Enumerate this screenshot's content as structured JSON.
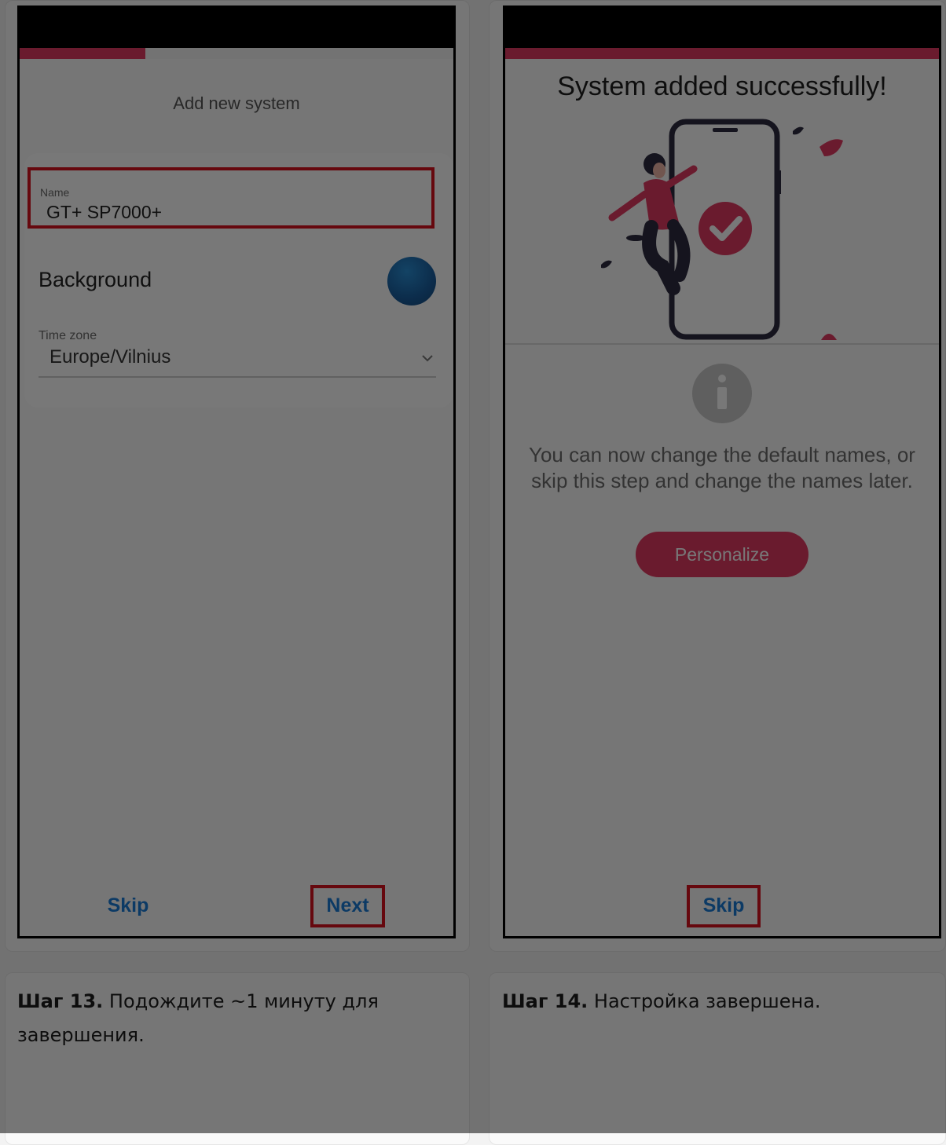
{
  "left_screen": {
    "header_title": "Add new system",
    "name_label": "Name",
    "name_value": "GT+ SP7000+",
    "background_label": "Background",
    "timezone_label": "Time zone",
    "timezone_value": "Europe/Vilnius",
    "skip_label": "Skip",
    "next_label": "Next",
    "progress_fraction": 0.29
  },
  "right_screen": {
    "title": "System added successfully!",
    "info_text": "You can now change the default names, or skip this step and change the names later.",
    "personalize_label": "Personalize",
    "skip_label": "Skip",
    "progress_fraction": 1.0
  },
  "captions": [
    {
      "step": "Шаг 13.",
      "text": " Подождите ~1 минуту для завершения."
    },
    {
      "step": "Шаг 14.",
      "text": " Настройка завершена."
    }
  ],
  "colors": {
    "accent": "#e23a62",
    "highlight": "#d8121e",
    "link": "#1b7bd6"
  }
}
